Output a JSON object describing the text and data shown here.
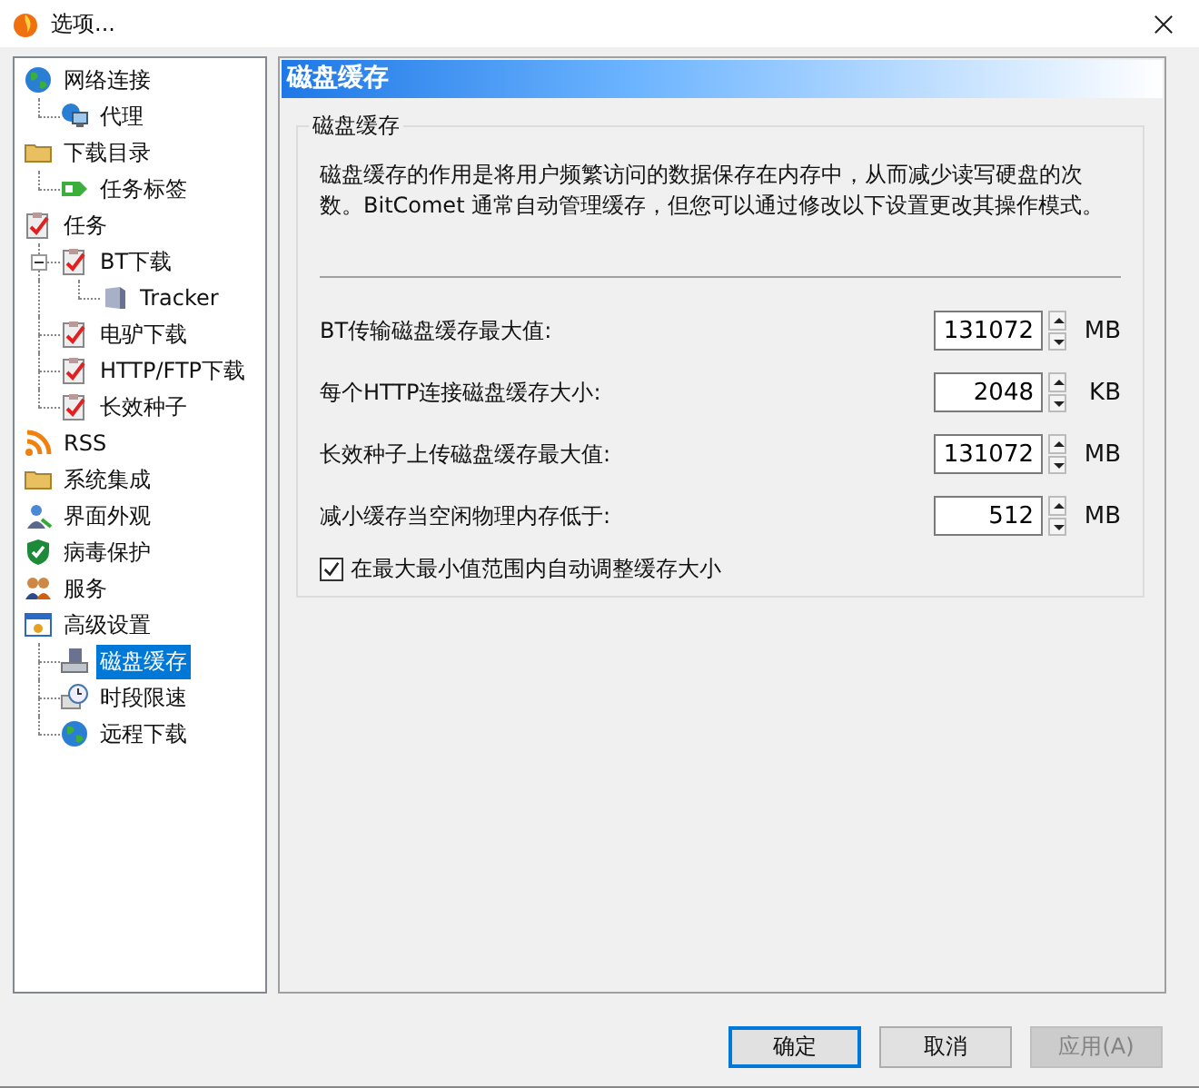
{
  "window": {
    "title": "选项..."
  },
  "tree": [
    {
      "label": "网络连接",
      "selected": false,
      "children": [
        {
          "label": "代理",
          "selected": false
        }
      ]
    },
    {
      "label": "下载目录",
      "selected": false,
      "children": [
        {
          "label": "任务标签",
          "selected": false
        }
      ]
    },
    {
      "label": "任务",
      "selected": false,
      "children": [
        {
          "label": "BT下载",
          "selected": false,
          "expanded": true,
          "children": [
            {
              "label": "Tracker",
              "selected": false
            }
          ]
        },
        {
          "label": "电驴下载",
          "selected": false
        },
        {
          "label": "HTTP/FTP下载",
          "selected": false
        },
        {
          "label": "长效种子",
          "selected": false
        }
      ]
    },
    {
      "label": "RSS",
      "selected": false
    },
    {
      "label": "系统集成",
      "selected": false
    },
    {
      "label": "界面外观",
      "selected": false
    },
    {
      "label": "病毒保护",
      "selected": false
    },
    {
      "label": "服务",
      "selected": false
    },
    {
      "label": "高级设置",
      "selected": false,
      "children": [
        {
          "label": "磁盘缓存",
          "selected": true
        },
        {
          "label": "时段限速",
          "selected": false
        },
        {
          "label": "远程下载",
          "selected": false
        }
      ]
    }
  ],
  "page": {
    "title": "磁盘缓存",
    "group_title": "磁盘缓存",
    "description": "磁盘缓存的作用是将用户频繁访问的数据保存在内存中，从而减少读写硬盘的次数。BitComet 通常自动管理缓存，但您可以通过修改以下设置更改其操作模式。",
    "settings": [
      {
        "label": "BT传输磁盘缓存最大值:",
        "value": "131072",
        "unit": "MB"
      },
      {
        "label": "每个HTTP连接磁盘缓存大小:",
        "value": "2048",
        "unit": "KB"
      },
      {
        "label": "长效种子上传磁盘缓存最大值:",
        "value": "131072",
        "unit": "MB"
      },
      {
        "label": "减小缓存当空闲物理内存低于:",
        "value": "512",
        "unit": "MB"
      }
    ],
    "auto_adjust": {
      "label": "在最大最小值范围内自动调整缓存大小",
      "checked": true
    }
  },
  "buttons": [
    {
      "label": "确定",
      "kind": "default",
      "disabled": false
    },
    {
      "label": "取消",
      "kind": "normal",
      "disabled": false
    },
    {
      "label": "应用(A)",
      "kind": "normal",
      "disabled": true
    }
  ]
}
